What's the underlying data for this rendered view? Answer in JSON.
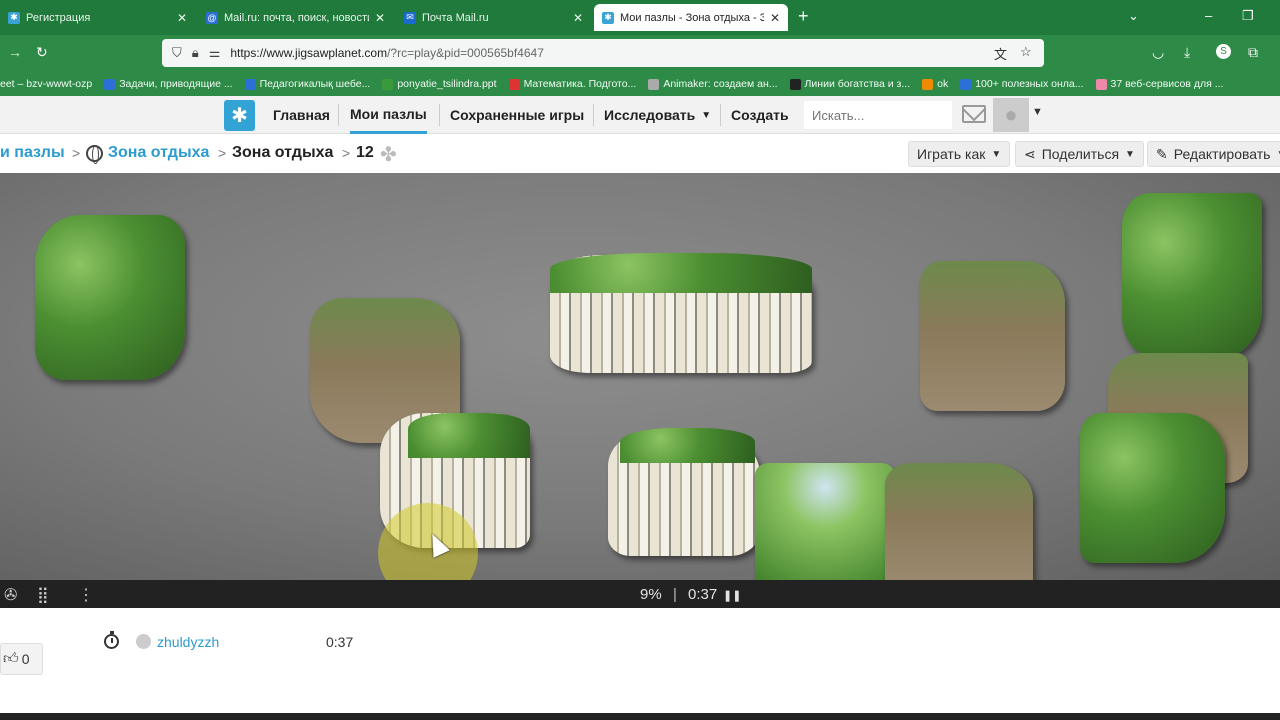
{
  "browser": {
    "tabs": [
      {
        "title": "Регистрация",
        "favicon_color": "#3aa3d6"
      },
      {
        "title": "Mail.ru: почта, поиск, новости",
        "favicon_color": "#2c6fd6"
      },
      {
        "title": "Почта Mail.ru",
        "favicon_color": "#1a6ad0"
      },
      {
        "title": "Мои пазлы - Зона отдыха - Зо",
        "favicon_color": "#3aa3d6",
        "active": true
      }
    ],
    "url_domain": "https://www.jigsawplanet.com",
    "url_path": "/?rc=play&pid=000565bf4647",
    "bookmarks": [
      {
        "label": "eet – bzv-wwwt-ozp",
        "color": ""
      },
      {
        "label": "Задачи, приводящие ...",
        "color": "#2c6fd6"
      },
      {
        "label": "Педагогикалық шебе...",
        "color": "#2c6fd6"
      },
      {
        "label": "ponyatie_tsilindra.ppt",
        "color": "#3a9a3a"
      },
      {
        "label": "Математика. Подгото...",
        "color": "#d33"
      },
      {
        "label": "Animaker: создаем ан...",
        "color": "#aaa"
      },
      {
        "label": "Линии богатства и з...",
        "color": "#222"
      },
      {
        "label": "ok",
        "color": "#f08a00"
      },
      {
        "label": "100+ полезных онла...",
        "color": "#2c6fd6"
      },
      {
        "label": "37 веб-сервисов для ...",
        "color": "#e8a"
      }
    ]
  },
  "site_nav": {
    "logo_icon": "puzzle-icon",
    "items": [
      "Главная",
      "Мои пазлы",
      "Сохраненные игры",
      "Исследовать",
      "Создать"
    ],
    "search_placeholder": "Искать..."
  },
  "breadcrumb": {
    "root": "и пазлы",
    "folder": "Зона отдыха",
    "puzzle": "Зона отдыха",
    "pieces": "12"
  },
  "actions": {
    "play_as": "Играть как",
    "share": "Поделиться",
    "edit": "Редактировать"
  },
  "player": {
    "progress": "9%",
    "separator": "|",
    "time": "0:37",
    "progress_value": 9
  },
  "scores": {
    "likes": "0",
    "user": "zhuldyzzh",
    "time": "0:37"
  },
  "colors": {
    "brand": "#33a3d6",
    "chrome_green": "#2e8a47"
  }
}
